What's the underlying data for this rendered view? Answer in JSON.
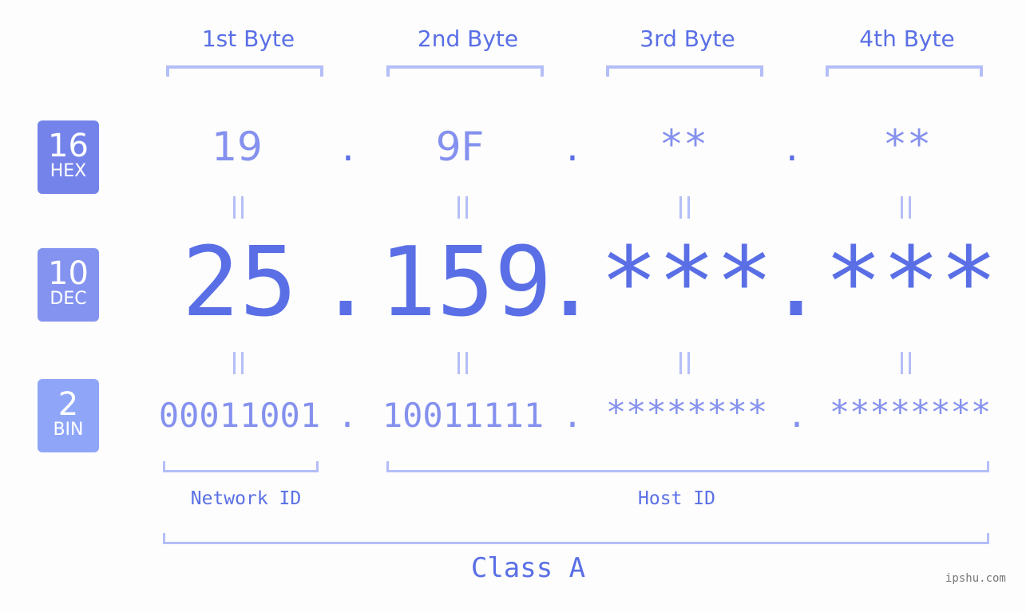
{
  "bytes": [
    {
      "label": "1st Byte",
      "hex": "19",
      "dec": "25",
      "bin": "00011001"
    },
    {
      "label": "2nd Byte",
      "hex": "9F",
      "dec": "159",
      "bin": "10011111"
    },
    {
      "label": "3rd Byte",
      "hex": "**",
      "dec": "***",
      "bin": "********"
    },
    {
      "label": "4th Byte",
      "hex": "**",
      "dec": "***",
      "bin": "********"
    }
  ],
  "separator": ".",
  "badges": {
    "hex": {
      "num": "16",
      "label": "HEX",
      "color": "#7483ea"
    },
    "dec": {
      "num": "10",
      "label": "DEC",
      "color": "#8493f0"
    },
    "bin": {
      "num": "2",
      "label": "BIN",
      "color": "#8fa6f8"
    }
  },
  "segments": {
    "network": "Network ID",
    "host": "Host ID",
    "class": "Class A"
  },
  "watermark": "ipshu.com",
  "colors": {
    "primary": "#5a6fe6",
    "secondary": "#8591ee",
    "bracket": "#b4bef8"
  }
}
